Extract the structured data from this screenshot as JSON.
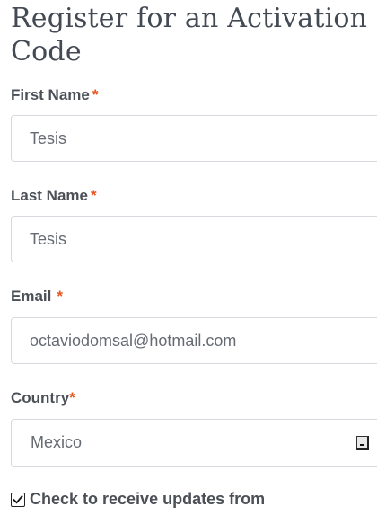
{
  "form": {
    "title": "Register for an Activation Code",
    "required_marker": "*",
    "first_name": {
      "label": "First Name",
      "value": "Tesis"
    },
    "last_name": {
      "label": "Last Name",
      "value": "Tesis"
    },
    "email": {
      "label": "Email",
      "value": "octaviodomsal@hotmail.com"
    },
    "country": {
      "label": "Country",
      "value": "Mexico"
    },
    "updates_checkbox": {
      "label": "Check to receive updates from",
      "checked": true
    }
  },
  "colors": {
    "required": "#e8551f",
    "text": "#4b5057",
    "border": "#d6d9dd"
  }
}
